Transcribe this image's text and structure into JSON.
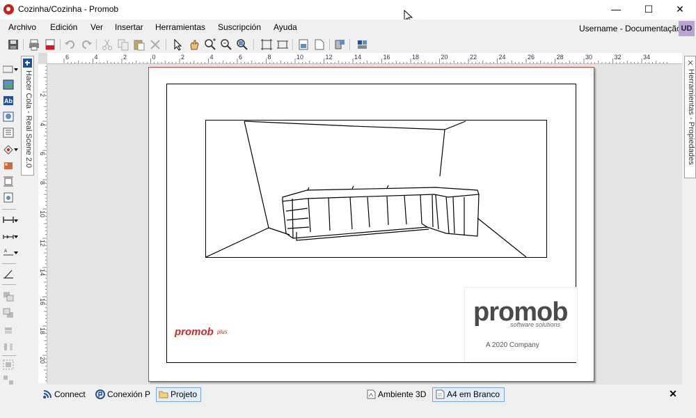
{
  "window": {
    "title": "Cozinha/Cozinha - Promob",
    "minimize_symbol": "—",
    "maximize_symbol": "☐",
    "close_symbol": "✕"
  },
  "menu": {
    "items": [
      "Archivo",
      "Edición",
      "Ver",
      "Insertar",
      "Herramientas",
      "Suscripción",
      "Ayuda"
    ]
  },
  "user": {
    "label": "Username - Documentação",
    "initials": "UD"
  },
  "side_tabs": {
    "left": "Hacer Cola - Real Scene 2.0",
    "right": "Herramientas - Propiedades"
  },
  "rulers": {
    "horizontal_labels": [
      "6",
      "4",
      "2",
      "0",
      "2",
      "4",
      "6",
      "8",
      "10",
      "12",
      "14",
      "16",
      "18",
      "20",
      "22",
      "24",
      "26",
      "28",
      "30",
      "32",
      "34"
    ],
    "vertical_labels": [
      "2",
      "4",
      "6",
      "8",
      "10",
      "12",
      "14",
      "16",
      "18",
      "20"
    ]
  },
  "page": {
    "logo_word": "promob",
    "logo_sub": "software solutions",
    "logo_company": "A 2020 Company",
    "small_brand": "promob",
    "small_brand_plus": "plus"
  },
  "bottom_tabs": {
    "left": [
      {
        "label": "Connect",
        "icon": "wifi-icon"
      },
      {
        "label": "Conexión P",
        "icon": "promob-connect-icon"
      },
      {
        "label": "Projeto",
        "icon": "folder-icon",
        "active": true
      }
    ],
    "right": [
      {
        "label": "Ambiente 3D",
        "icon": "ambient-3d-icon"
      },
      {
        "label": "A4 em Branco",
        "icon": "a4-page-icon",
        "active": true
      }
    ],
    "close_symbol": "✕"
  },
  "colors": {
    "brand_red": "#d4262a",
    "avatar_bg": "#bba4d4",
    "active_tab_border": "#7ea6d4",
    "page_border": "#d13a3a"
  }
}
